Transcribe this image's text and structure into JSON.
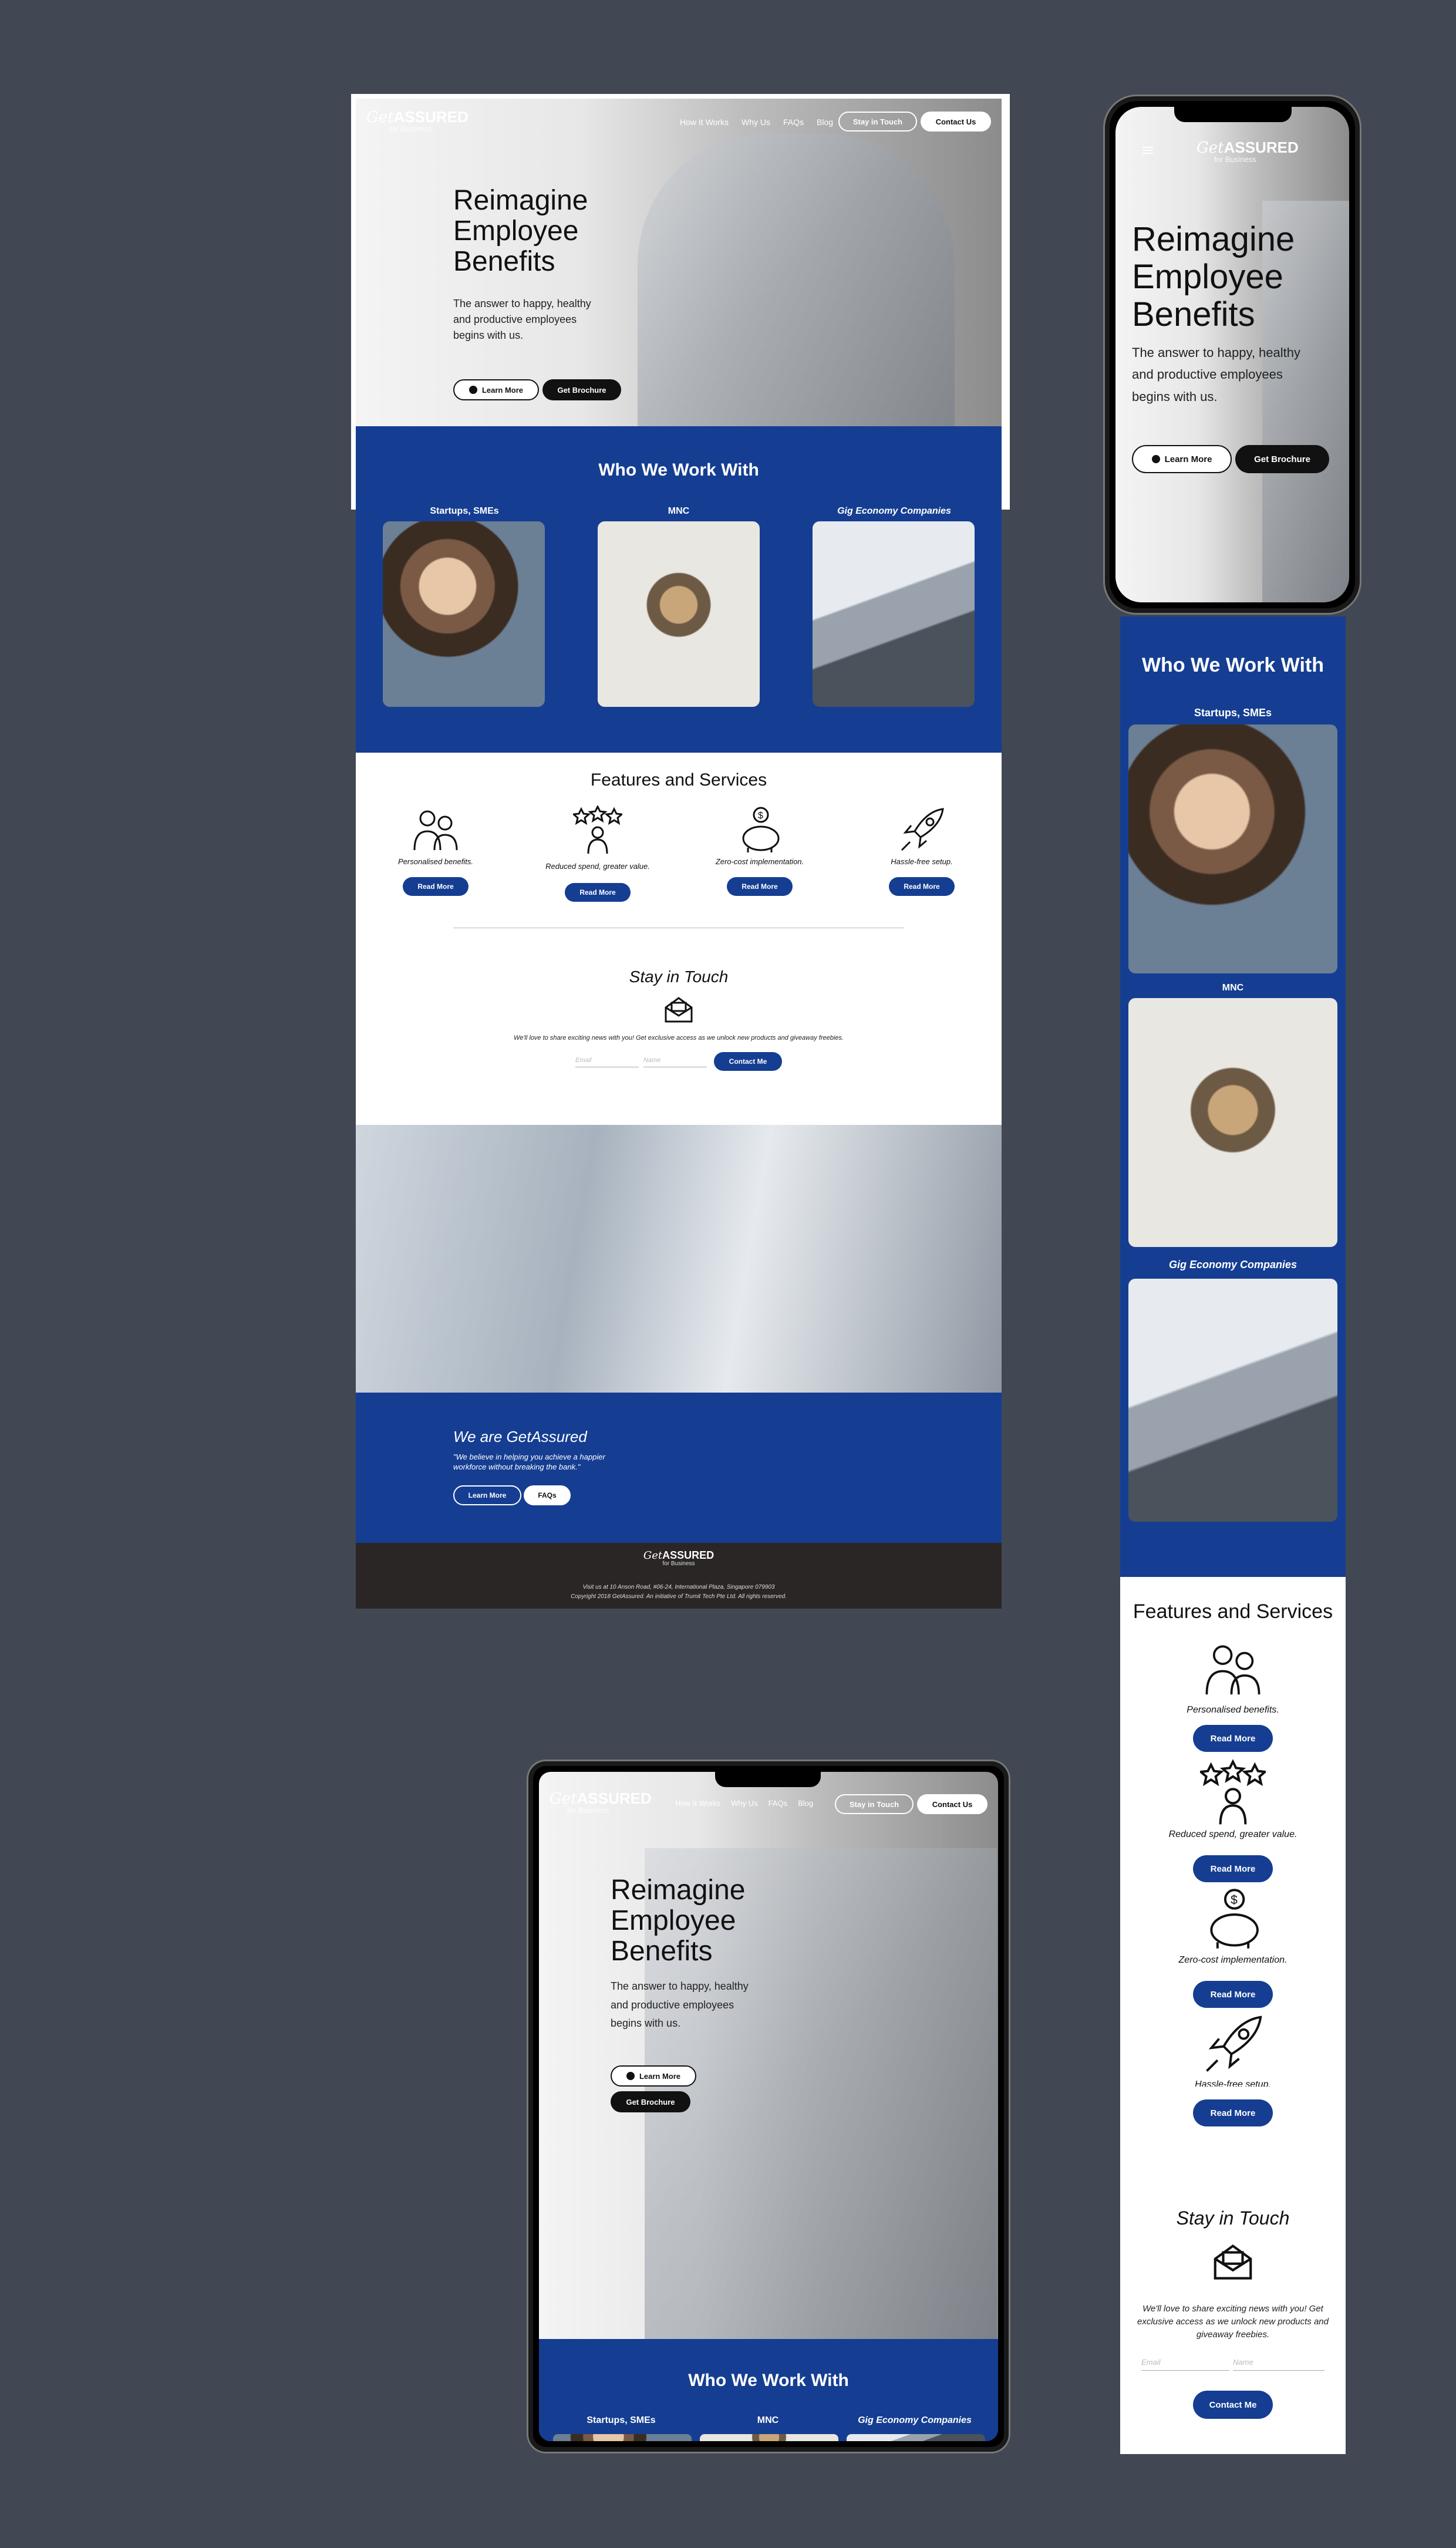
{
  "brand": {
    "get": "Get",
    "assured": "ASSURED",
    "sub": "for Business"
  },
  "nav": {
    "items": [
      "How It Works",
      "Why Us",
      "FAQs",
      "Blog"
    ],
    "stay": "Stay in Touch",
    "contact": "Contact Us"
  },
  "hero": {
    "title_1": "Reimagine",
    "title_2": "Employee",
    "title_3": "Benefits",
    "text_1": "The answer to happy, healthy",
    "text_2": "and productive employees",
    "text_3": "begins with us.",
    "learn": "Learn More",
    "brochure": "Get Brochure"
  },
  "who": {
    "title": "Who We Work With",
    "cats": [
      "Startups, SMEs",
      "MNC",
      "Gig Economy Companies"
    ]
  },
  "features": {
    "title": "Features and Services",
    "items": [
      "Personalised benefits.",
      "Reduced spend, greater value.",
      "Zero-cost implementation.",
      "Hassle-free setup."
    ],
    "btn": "Read More"
  },
  "stay": {
    "title": "Stay in Touch",
    "text": "We'll love to share exciting news with you! Get exclusive access as we unlock new products and giveaway freebies.",
    "mob_text_1": "We'll love to share exciting news with you! Get",
    "mob_text_2": "exclusive access as we unlock new products and",
    "mob_text_3": "giveaway freebies.",
    "email": "Email",
    "name": "Name",
    "btn": "Contact Me"
  },
  "about": {
    "title": "We are GetAssured",
    "quote_1": "\"We believe in helping you achieve a happier",
    "quote_2": "workforce without breaking the bank.\"",
    "learn": "Learn More",
    "faqs": "FAQs"
  },
  "footer": {
    "addr": "Visit us at 10 Anson Road, #06-24, International Plaza, Singapore 079903",
    "copy": "Copyright 2018 GetAssured. An initiative of Trumit Tech Pte Ltd. All rights reserved."
  },
  "colors": {
    "blue": "#153e92",
    "dark": "#2b2626",
    "bg": "#414853"
  }
}
